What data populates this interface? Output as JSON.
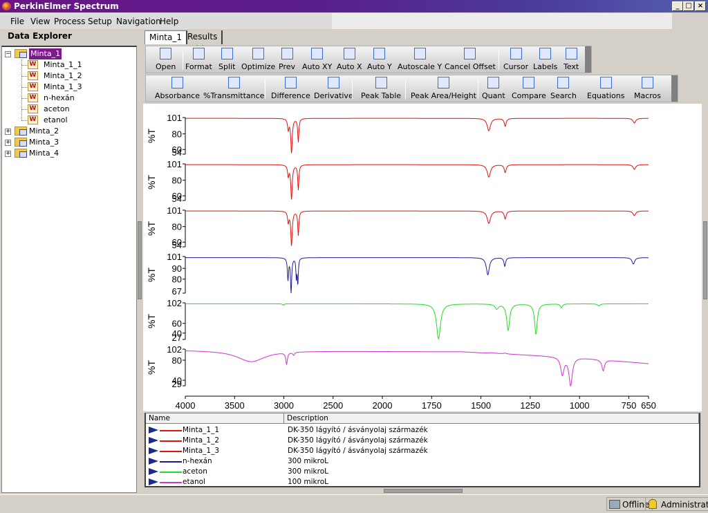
{
  "app": {
    "title": "PerkinElmer Spectrum",
    "window_buttons": [
      "_",
      "□",
      "×"
    ]
  },
  "menu": [
    "File",
    "View",
    "Process",
    "Setup",
    "Navigation",
    "Help"
  ],
  "explorer": {
    "title": "Data Explorer",
    "tree": [
      {
        "label": "Minta_1",
        "expanded": true,
        "selected": true,
        "children": [
          "Minta_1_1",
          "Minta_1_2",
          "Minta_1_3",
          "n-hexán",
          "aceton",
          "etanol"
        ]
      },
      {
        "label": "Minta_2",
        "expanded": false
      },
      {
        "label": "Minta_3",
        "expanded": false
      },
      {
        "label": "Minta_4",
        "expanded": false
      }
    ]
  },
  "tabs": [
    "Minta_1",
    "Results Table"
  ],
  "toolbar1": [
    {
      "label": "Open",
      "icon": "folder-open-icon"
    },
    {
      "label": "Format",
      "icon": "format-icon"
    },
    {
      "label": "Split",
      "icon": "split-icon"
    },
    {
      "label": "Optimize",
      "icon": "optimize-icon"
    },
    {
      "label": "Prev",
      "icon": "prev-icon"
    },
    {
      "label": "Auto XY",
      "icon": "auto-xy-icon"
    },
    {
      "label": "Auto X",
      "icon": "auto-x-icon"
    },
    {
      "label": "Auto Y",
      "icon": "auto-y-icon"
    },
    {
      "label": "Autoscale Y",
      "icon": "autoscale-y-icon"
    },
    {
      "label": "Cancel Offset",
      "icon": "cancel-offset-icon"
    },
    {
      "label": "Cursor",
      "icon": "cursor-icon"
    },
    {
      "label": "Labels",
      "icon": "labels-icon"
    },
    {
      "label": "Text",
      "icon": "text-icon"
    }
  ],
  "toolbar2": [
    {
      "label": "Absorbance",
      "icon": "absorbance-icon"
    },
    {
      "label": "%Transmittance",
      "icon": "transmittance-icon"
    },
    {
      "label": "Difference",
      "icon": "difference-icon"
    },
    {
      "label": "Derivative",
      "icon": "derivative-icon"
    },
    {
      "label": "Peak Table",
      "icon": "peak-table-icon"
    },
    {
      "label": "Peak Area/Height",
      "icon": "peak-area-icon"
    },
    {
      "label": "Quant",
      "icon": "quant-icon"
    },
    {
      "label": "Compare",
      "icon": "compare-icon"
    },
    {
      "label": "Search",
      "icon": "search-icon"
    },
    {
      "label": "Equations",
      "icon": "equations-icon"
    },
    {
      "label": "Macros",
      "icon": "macros-icon"
    }
  ],
  "chart_data": {
    "type": "line",
    "xlabel": "cm-1",
    "xlim": [
      4000,
      650
    ],
    "x_ticks": [
      4000,
      3500,
      3000,
      2500,
      2000,
      1750,
      1500,
      1250,
      1000,
      750,
      650
    ],
    "x_scale": "expanded 2x below 2000",
    "ylabel": "%T",
    "grid": false,
    "panels": [
      {
        "name": "Minta_1_1",
        "color": "#dd1111",
        "ylim": [
          54,
          101
        ],
        "y_ticks": [
          101,
          80,
          60,
          54
        ],
        "baseline": 100,
        "peaks": [
          [
            2955,
            86,
            8
          ],
          [
            2922,
            56,
            9
          ],
          [
            2853,
            70,
            7
          ],
          [
            1460,
            84,
            10
          ],
          [
            1377,
            90,
            6
          ],
          [
            722,
            94,
            8
          ]
        ]
      },
      {
        "name": "Minta_1_2",
        "color": "#dd1111",
        "ylim": [
          54,
          101
        ],
        "y_ticks": [
          101,
          80,
          60,
          54
        ],
        "baseline": 100,
        "peaks": [
          [
            2955,
            86,
            8
          ],
          [
            2922,
            56,
            9
          ],
          [
            2853,
            68,
            7
          ],
          [
            1460,
            84,
            10
          ],
          [
            1377,
            90,
            6
          ],
          [
            722,
            94,
            8
          ]
        ]
      },
      {
        "name": "Minta_1_3",
        "color": "#dd1111",
        "ylim": [
          54,
          101
        ],
        "y_ticks": [
          101,
          80,
          60,
          54
        ],
        "baseline": 100,
        "peaks": [
          [
            2955,
            86,
            8
          ],
          [
            2922,
            56,
            9
          ],
          [
            2853,
            69,
            7
          ],
          [
            1460,
            84,
            10
          ],
          [
            1377,
            90,
            6
          ],
          [
            722,
            94,
            8
          ]
        ]
      },
      {
        "name": "n-hexán",
        "color": "#1a1a9a",
        "ylim": [
          67,
          101
        ],
        "y_ticks": [
          101,
          90,
          80,
          67
        ],
        "baseline": 100,
        "peaks": [
          [
            2958,
            80,
            7
          ],
          [
            2926,
            68,
            7
          ],
          [
            2873,
            82,
            5
          ],
          [
            2858,
            76,
            6
          ],
          [
            1465,
            84,
            9
          ],
          [
            1379,
            92,
            5
          ],
          [
            727,
            94,
            8
          ]
        ]
      },
      {
        "name": "aceton",
        "color": "#22dd22",
        "ylim": [
          27,
          102
        ],
        "y_ticks": [
          102,
          60,
          40,
          27
        ],
        "baseline": 100,
        "peaks": [
          [
            3005,
            97,
            8
          ],
          [
            1715,
            28,
            12
          ],
          [
            1420,
            90,
            10
          ],
          [
            1362,
            46,
            9
          ],
          [
            1221,
            38,
            8
          ],
          [
            1092,
            92,
            6
          ],
          [
            902,
            96,
            8
          ]
        ]
      },
      {
        "name": "etanol",
        "color": "#cc33cc",
        "ylim": [
          29,
          102
        ],
        "y_ticks": [
          102,
          80,
          40,
          29
        ],
        "baseline": 100,
        "baseline_slope": [
          [
            4000,
            100
          ],
          [
            1600,
            97
          ],
          [
            1000,
            85
          ],
          [
            650,
            73
          ]
        ],
        "peaks": [
          [
            3330,
            77,
            170
          ],
          [
            2972,
            76,
            10
          ],
          [
            2900,
            93,
            10
          ],
          [
            1450,
            95,
            20
          ],
          [
            1380,
            94,
            10
          ],
          [
            1087,
            52,
            10
          ],
          [
            1045,
            30,
            10
          ],
          [
            880,
            59,
            8
          ]
        ]
      }
    ]
  },
  "legend": {
    "columns": [
      "Name",
      "Description"
    ],
    "rows": [
      {
        "name": "Minta_1_1",
        "description": "DK-350 lágyító / ásványolaj származék",
        "color": "#dd1111"
      },
      {
        "name": "Minta_1_2",
        "description": "DK-350 lágyító / ásványolaj származék",
        "color": "#dd1111"
      },
      {
        "name": "Minta_1_3",
        "description": "DK-350 lágyító / ásványolaj származék",
        "color": "#dd1111"
      },
      {
        "name": "n-hexán",
        "description": "300 mikroL",
        "color": "#1a1a9a"
      },
      {
        "name": "aceton",
        "description": "300 mikroL",
        "color": "#22dd22"
      },
      {
        "name": "etanol",
        "description": "100 mikroL",
        "color": "#cc33cc"
      }
    ]
  },
  "status": {
    "connection": "Offline",
    "user": "Administrator"
  }
}
